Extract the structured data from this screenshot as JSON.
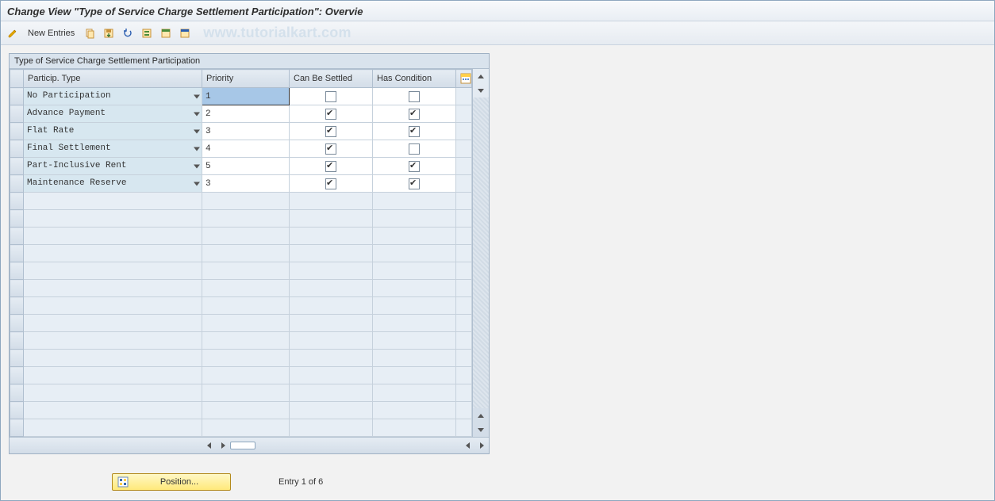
{
  "window": {
    "title": "Change View \"Type of Service Charge Settlement Participation\": Overvie"
  },
  "toolbar": {
    "new_entries_label": "New Entries",
    "watermark": "www.tutorialkart.com"
  },
  "panel": {
    "title": "Type of Service Charge Settlement Participation"
  },
  "columns": {
    "particip_type": "Particip. Type",
    "priority": "Priority",
    "can_be_settled": "Can Be Settled",
    "has_condition": "Has Condition"
  },
  "rows": [
    {
      "type": "No Participation",
      "priority": "1",
      "can_be_settled": false,
      "has_condition": false,
      "active": true
    },
    {
      "type": "Advance Payment",
      "priority": "2",
      "can_be_settled": true,
      "has_condition": true,
      "active": false
    },
    {
      "type": "Flat Rate",
      "priority": "3",
      "can_be_settled": true,
      "has_condition": true,
      "active": false
    },
    {
      "type": "Final Settlement",
      "priority": "4",
      "can_be_settled": true,
      "has_condition": false,
      "active": false
    },
    {
      "type": "Part-Inclusive Rent",
      "priority": "5",
      "can_be_settled": true,
      "has_condition": true,
      "active": false
    },
    {
      "type": "Maintenance Reserve",
      "priority": "3",
      "can_be_settled": true,
      "has_condition": true,
      "active": false
    }
  ],
  "empty_rows": 14,
  "footer": {
    "position_label": "Position...",
    "entry_label": "Entry 1 of 6"
  }
}
